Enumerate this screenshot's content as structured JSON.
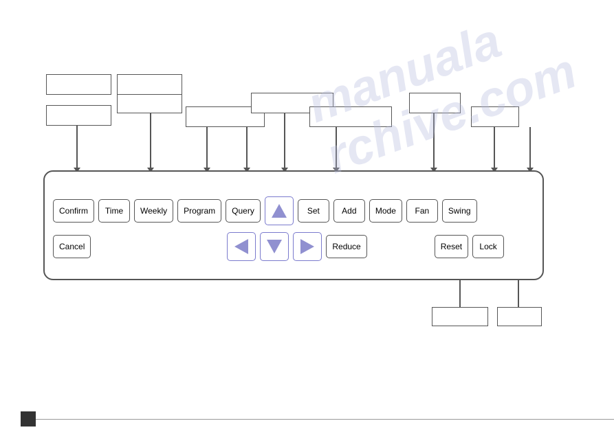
{
  "watermark": {
    "line1": "manuala",
    "line2": "rchive.com"
  },
  "panel": {
    "buttons_row1": [
      {
        "label": "Confirm",
        "id": "confirm"
      },
      {
        "label": "Time",
        "id": "time"
      },
      {
        "label": "Weekly",
        "id": "weekly"
      },
      {
        "label": "Program",
        "id": "program"
      },
      {
        "label": "Query",
        "id": "query"
      },
      {
        "label": "▲",
        "id": "up",
        "triangle": true,
        "dir": "up"
      },
      {
        "label": "Set",
        "id": "set"
      },
      {
        "label": "Add",
        "id": "add"
      },
      {
        "label": "Mode",
        "id": "mode"
      },
      {
        "label": "Fan",
        "id": "fan"
      },
      {
        "label": "Swing",
        "id": "swing"
      }
    ],
    "buttons_row2": [
      {
        "label": "Cancel",
        "id": "cancel"
      },
      {
        "label": "◁",
        "id": "left",
        "triangle": true,
        "dir": "left"
      },
      {
        "label": "▽",
        "id": "down",
        "triangle": true,
        "dir": "down"
      },
      {
        "label": "▷",
        "id": "right",
        "triangle": true,
        "dir": "right"
      },
      {
        "label": "Reduce",
        "id": "reduce"
      },
      {
        "label": "Reset",
        "id": "reset"
      },
      {
        "label": "Lock",
        "id": "lock"
      }
    ]
  },
  "label_boxes": [
    {
      "id": "lb1",
      "label": ""
    },
    {
      "id": "lb2",
      "label": ""
    },
    {
      "id": "lb3",
      "label": ""
    },
    {
      "id": "lb4",
      "label": ""
    },
    {
      "id": "lb5",
      "label": ""
    },
    {
      "id": "lb6",
      "label": ""
    },
    {
      "id": "lb7",
      "label": ""
    },
    {
      "id": "lb8",
      "label": ""
    },
    {
      "id": "lb9",
      "label": ""
    },
    {
      "id": "lb10",
      "label": ""
    },
    {
      "id": "lb11",
      "label": ""
    },
    {
      "id": "lb12",
      "label": ""
    }
  ]
}
